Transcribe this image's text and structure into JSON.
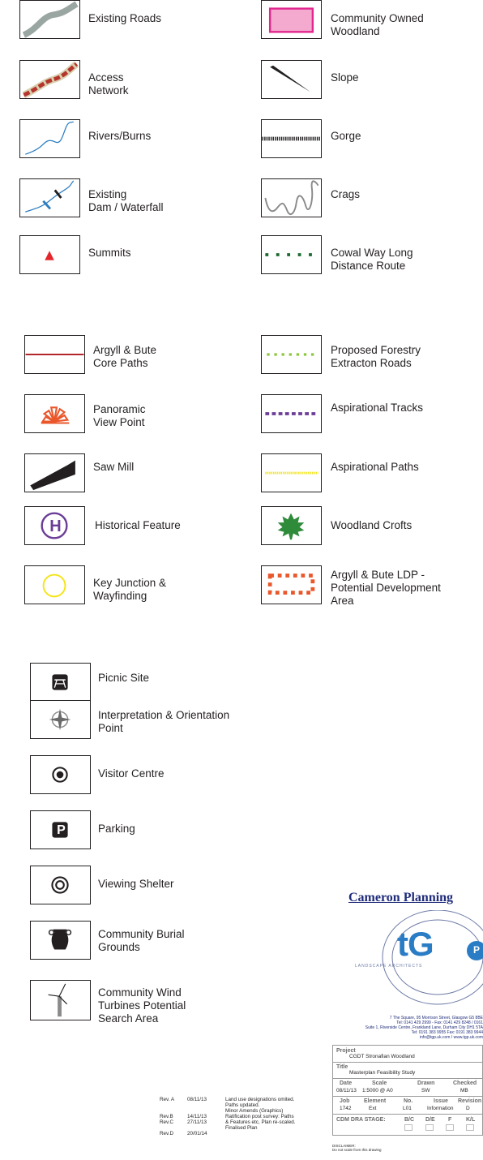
{
  "legend": {
    "existing_roads": "Existing Roads",
    "community_woodland": "Community Owned\nWoodland",
    "access_network": "Access\nNetwork",
    "slope": "Slope",
    "rivers": "Rivers/Burns",
    "gorge": "Gorge",
    "dam": "Existing\nDam / Waterfall",
    "crags": "Crags",
    "summits": "Summits",
    "cowal_way": "Cowal Way Long\nDistance Route",
    "core_paths": "Argyll & Bute\nCore Paths",
    "forestry_roads": "Proposed Forestry\nExtracton Roads",
    "view_point": "Panoramic\nView Point",
    "aspirational_tracks": "Aspirational Tracks",
    "saw_mill": "Saw Mill",
    "aspirational_paths": "Aspirational Paths",
    "historical": "Historical Feature",
    "historical_glyph": "H",
    "woodland_crofts": "Woodland Crofts",
    "key_junction": "Key Junction &\nWayfinding",
    "ldp_area": "Argyll & Bute LDP -\nPotential Development\nArea",
    "picnic": "Picnic Site",
    "interpretation": "Interpretation & Orientation\nPoint",
    "visitor_centre": "Visitor Centre",
    "parking": "Parking",
    "parking_glyph": "P",
    "viewing_shelter": "Viewing Shelter",
    "burial": "Community Burial\nGrounds",
    "wind": "Community Wind\nTurbines Potential\nSearch Area"
  },
  "revisions": {
    "rev_ids": "Rev. A\n\n\nRev.B\nRev.C\n\nRev.D",
    "rev_dates": "08/11/13\n\n\n14/11/13\n27/11/13\n\n20/01/14",
    "rev_notes": "Land use designations omited.\nPaths updated.\nMinor Amends (Graphics)\nRatification post survey: Paths\n& Features etc, Plan re-scaled.\nFinalised Plan"
  },
  "title_block": {
    "heading": "Cameron Planning",
    "logo_text": "tG",
    "logo_p": "P",
    "logo_caption": "LANDSCAPE ARCHITECTS",
    "address": "7 The Square, 95 Morrison Street, Glasgow G5 8BE\nTel: 0141 429 2999 - Fax: 0141 429 8248 / 0161\nSuite 1, Riverside Centre, Frankland Lane, Durham City DH1 5TA\nTel: 0191 383 9955 Fax: 0191 383 9944\ninfo@tgp.uk.com / www.tgp.uk.com",
    "project_label": "Project",
    "project_value": "CGDT Stronafian Woodland",
    "title_label": "Title",
    "title_value": "Masterplan Feasibility Study",
    "date_label": "Date",
    "date_value": "08/11/13",
    "scale_label": "Scale",
    "scale_value": "1:5000 @ A0",
    "drawn_label": "Drawn",
    "drawn_value": "SW",
    "checked_label": "Checked",
    "checked_value": "MB",
    "job_label": "Job",
    "job_value": "1742",
    "element_label": "Element",
    "element_value": "Ext",
    "no_label": "No.",
    "no_value": "L01",
    "issue_label": "Issue",
    "issue_value": "Information",
    "revision_label": "Revision",
    "revision_value": "D",
    "cdm_label": "CDM DRA STAGE:",
    "stage_bc": "B/C",
    "stage_de": "D/E",
    "stage_f": "F",
    "stage_kl": "K/L",
    "disclaimer": "DISCLAIMER:\nDo not scale from this drawing"
  }
}
